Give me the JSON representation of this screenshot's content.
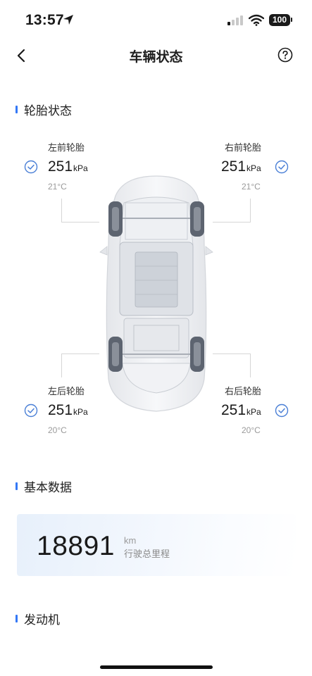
{
  "status_bar": {
    "time": "13:57",
    "battery": "100"
  },
  "nav": {
    "title": "车辆状态",
    "back_icon": "chevron-left-icon",
    "help_icon": "question-circle-icon"
  },
  "sections": {
    "tire": "轮胎状态",
    "basic": "基本数据",
    "engine": "发动机"
  },
  "tires": {
    "front_left": {
      "label": "左前轮胎",
      "pressure": "251",
      "unit": "kPa",
      "temp": "21°C",
      "status": "ok"
    },
    "front_right": {
      "label": "右前轮胎",
      "pressure": "251",
      "unit": "kPa",
      "temp": "21°C",
      "status": "ok"
    },
    "rear_left": {
      "label": "左后轮胎",
      "pressure": "251",
      "unit": "kPa",
      "temp": "20°C",
      "status": "ok"
    },
    "rear_right": {
      "label": "右后轮胎",
      "pressure": "251",
      "unit": "kPa",
      "temp": "20°C",
      "status": "ok"
    }
  },
  "basic_data": {
    "odometer_value": "18891",
    "odometer_unit": "km",
    "odometer_label": "行驶总里程"
  },
  "colors": {
    "accent": "#3478f6",
    "check": "#4a7fd6",
    "muted": "#9a9a9a"
  }
}
